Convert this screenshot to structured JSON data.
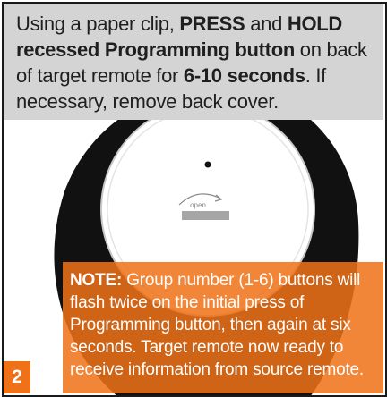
{
  "instruction": {
    "t1": "Using a paper clip, ",
    "press": "PRESS",
    "t2": " and ",
    "hold": "HOLD",
    "t3": " ",
    "button_name": "recessed Programming button",
    "t4": " on back of target remote for ",
    "duration": "6-10 seconds",
    "t5": ".  If necessary, remove back cover."
  },
  "remote": {
    "cover_label": "open"
  },
  "note": {
    "label": "NOTE:",
    "text": "  Group number (1-6) buttons will flash twice on the initial press of Programming button, then again at six seconds.  Target remote now ready to receive information from source remote."
  },
  "step_number": "2",
  "colors": {
    "accent": "#ef7219",
    "instruction_bg": "#d4d4d4",
    "remote_body": "#111111",
    "cover_fill": "#ffffff",
    "cover_slot": "#a6a6a6"
  }
}
